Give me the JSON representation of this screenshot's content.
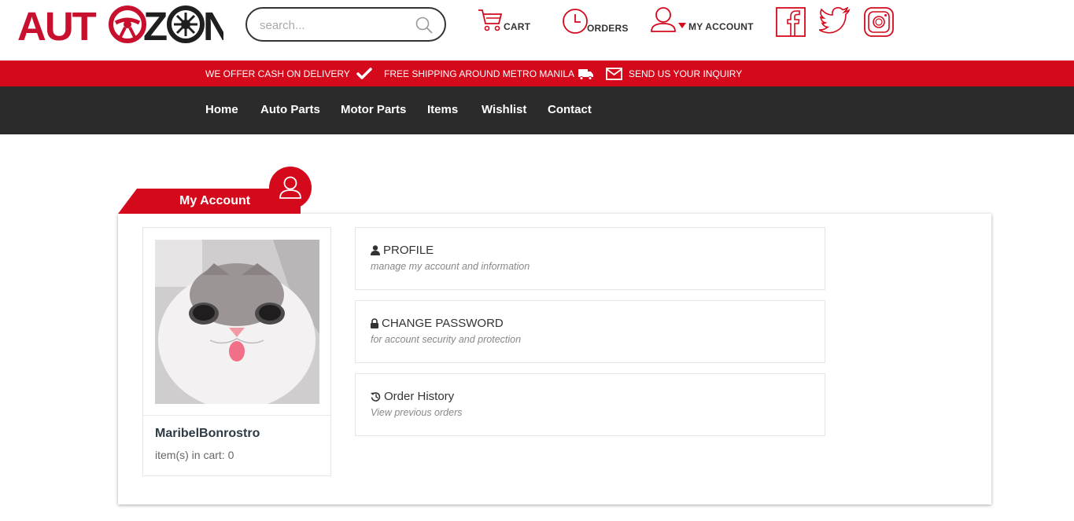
{
  "header": {
    "logo_text": "AUTOZON",
    "search_placeholder": "search...",
    "cart_label": "CART",
    "orders_label": "ORDERS",
    "account_label": "MY ACCOUNT",
    "social": [
      "facebook-icon",
      "twitter-icon",
      "instagram-icon"
    ]
  },
  "banner": {
    "cod": "WE OFFER CASH ON DELIVERY",
    "shipping": "FREE SHIPPING AROUND METRO MANILA",
    "inquiry": "SEND US YOUR INQUIRY"
  },
  "nav": {
    "items": [
      "Home",
      "Auto Parts",
      "Motor Parts",
      "Items",
      "Wishlist",
      "Contact"
    ]
  },
  "account": {
    "tab_title": "My Account",
    "username": "MaribelBonrostro",
    "cart_text": "item(s) in cart: 0",
    "options": [
      {
        "title": "PROFILE",
        "subtitle": "manage my account and information",
        "icon": "user-icon"
      },
      {
        "title": "CHANGE PASSWORD",
        "subtitle": "for account security and protection",
        "icon": "lock-icon"
      },
      {
        "title": "Order History",
        "subtitle": "View previous orders",
        "icon": "history-icon"
      }
    ]
  },
  "colors": {
    "brand_red": "#d4091b",
    "nav_dark": "#2b2b2b"
  }
}
